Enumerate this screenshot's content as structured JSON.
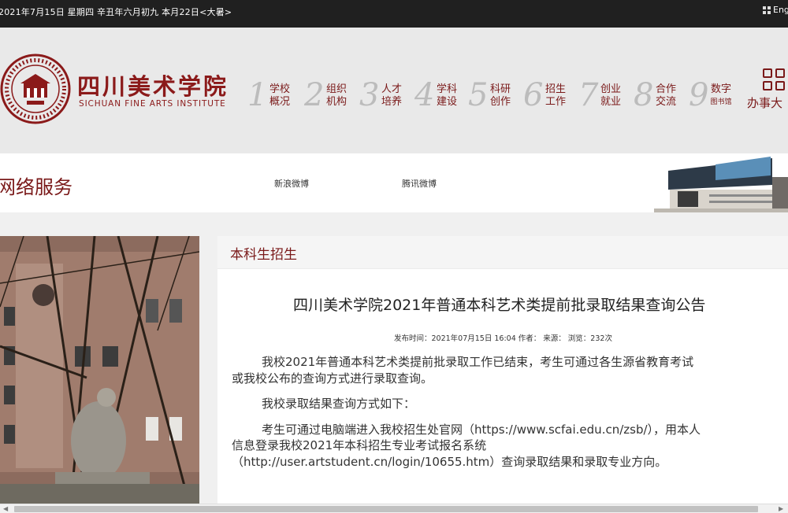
{
  "topbar": {
    "date_text": "2021年7月15日  星期四  辛丑年六月初九  本月22日<大暑>",
    "lang_label": "Eng"
  },
  "header": {
    "logo_cn": "四川美术学院",
    "logo_en": "SICHUAN FINE ARTS INSTITUTE",
    "nav": [
      {
        "num": "1",
        "line1": "学校",
        "line2": "概况"
      },
      {
        "num": "2",
        "line1": "组织",
        "line2": "机构"
      },
      {
        "num": "3",
        "line1": "人才",
        "line2": "培养"
      },
      {
        "num": "4",
        "line1": "学科",
        "line2": "建设"
      },
      {
        "num": "5",
        "line1": "科研",
        "line2": "创作"
      },
      {
        "num": "6",
        "line1": "招生",
        "line2": "工作"
      },
      {
        "num": "7",
        "line1": "创业",
        "line2": "就业"
      },
      {
        "num": "8",
        "line1": "合作",
        "line2": "交流"
      },
      {
        "num": "9",
        "line1": "数字",
        "line2": "图书馆"
      }
    ],
    "office_label": "办事大"
  },
  "network": {
    "title": "网络服务",
    "links": [
      "新浪微博",
      "腾讯微博"
    ]
  },
  "article": {
    "section_title": "本科生招生",
    "title": "四川美术学院2021年普通本科艺术类提前批录取结果查询公告",
    "meta": "发布时间：2021年07月15日 16:04   作者：   来源：    浏览：232次",
    "paragraphs": [
      "我校2021年普通本科艺术类提前批录取工作已结束，考生可通过各生源省教育考试",
      "或我校公布的查询方式进行录取查询。",
      "我校录取结果查询方式如下：",
      "考生可通过电脑端进入我校招生处官网（https://www.scfai.edu.cn/zsb/），用本人",
      "信息登录我校2021年本科招生专业考试报名系统",
      "（http://user.artstudent.cn/login/10655.htm）查询录取结果和录取专业方向。"
    ]
  },
  "colors": {
    "brand": "#7a1919",
    "topbar": "#202020"
  }
}
